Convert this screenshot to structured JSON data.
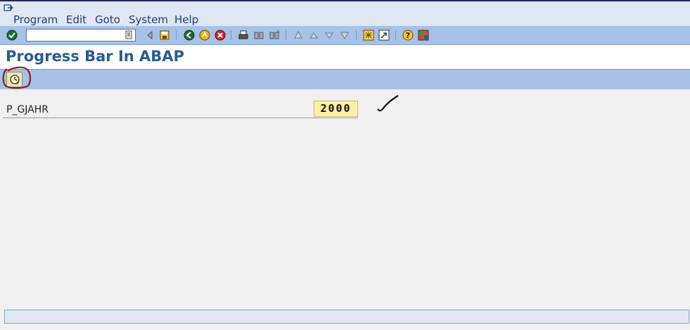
{
  "menubar": {
    "items": [
      "Program",
      "Edit",
      "Goto",
      "System",
      "Help"
    ]
  },
  "toolbar": {
    "command_value": "",
    "icons": [
      "enter-icon",
      "command-dropdown-icon",
      "back-arrow-icon",
      "save-icon",
      "back-icon",
      "exit-icon",
      "cancel-icon",
      "print-icon",
      "find-icon",
      "find-next-icon",
      "first-page-icon",
      "previous-page-icon",
      "next-page-icon",
      "last-page-icon",
      "create-session-icon",
      "shortcut-icon",
      "help-icon",
      "layout-menu-icon"
    ]
  },
  "title": {
    "text": "Progress Bar In ABAP"
  },
  "app_toolbar": {
    "execute_icon": "execute-clock-icon"
  },
  "selection_screen": {
    "parameter_label": "P_GJAHR",
    "parameter_value": "2000"
  },
  "colors": {
    "menubar_bg": "#dfe7f3",
    "toolbar_bg": "#a7c1e6",
    "title_text": "#2a5c8e",
    "input_bg": "#ffefa3",
    "annotation_circle": "#8b1a2a"
  }
}
